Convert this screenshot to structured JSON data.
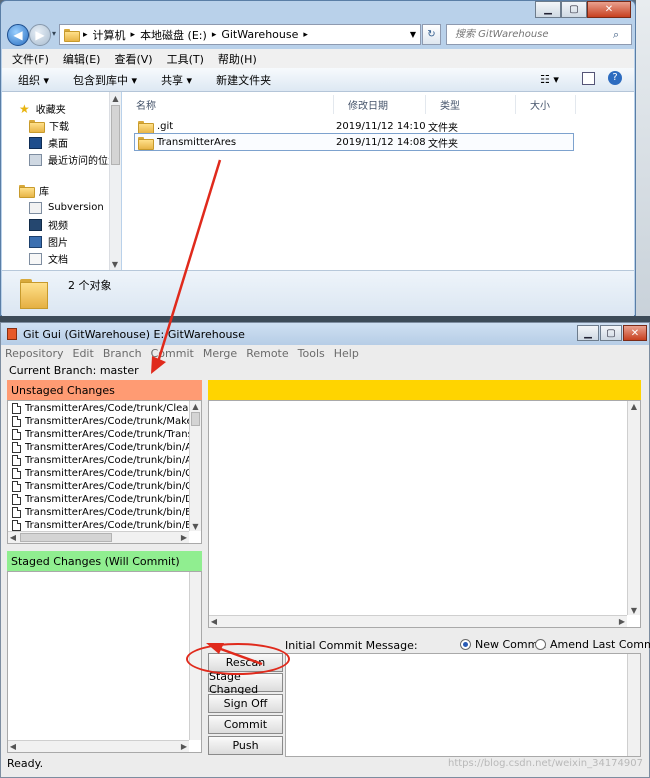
{
  "explorer": {
    "breadcrumb": [
      "计算机",
      "本地磁盘 (E:)",
      "GitWarehouse"
    ],
    "search_placeholder": "搜索 GitWarehouse",
    "menu": [
      "文件(F)",
      "编辑(E)",
      "查看(V)",
      "工具(T)",
      "帮助(H)"
    ],
    "toolbar": [
      "组织 ▾",
      "包含到库中 ▾",
      "共享 ▾",
      "新建文件夹"
    ],
    "nav": {
      "favorites": "收藏夹",
      "fav_items": [
        "下载",
        "桌面",
        "最近访问的位置"
      ],
      "library": "库",
      "lib_items": [
        "Subversion",
        "视频",
        "图片",
        "文档"
      ]
    },
    "columns": [
      "名称",
      "修改日期",
      "类型",
      "大小"
    ],
    "files": [
      {
        "name": ".git",
        "date": "2019/11/12 14:10",
        "type": "文件夹"
      },
      {
        "name": "TransmitterAres",
        "date": "2019/11/12 14:08",
        "type": "文件夹"
      }
    ],
    "status": "2 个对象"
  },
  "gitgui": {
    "title": "Git Gui (GitWarehouse) E:/GitWarehouse",
    "menu": [
      "Repository",
      "Edit",
      "Branch",
      "Commit",
      "Merge",
      "Remote",
      "Tools",
      "Help"
    ],
    "branch": "Current Branch: master",
    "unstaged_title": "Unstaged Changes",
    "unstaged_files": [
      "TransmitterAres/Code/trunk/CleanSo",
      "TransmitterAres/Code/trunk/Makefil",
      "TransmitterAres/Code/trunk/Transm",
      "TransmitterAres/Code/trunk/bin/ACI",
      "TransmitterAres/Code/trunk/bin/ACI",
      "TransmitterAres/Code/trunk/bin/Clo",
      "TransmitterAres/Code/trunk/bin/Cor",
      "TransmitterAres/Code/trunk/bin/Dev",
      "TransmitterAres/Code/trunk/bin/Env",
      "TransmitterAres/Code/trunk/bin/Env"
    ],
    "staged_title": "Staged Changes (Will Commit)",
    "commit_label": "Initial Commit Message:",
    "radio_new": "New Commit",
    "radio_amend": "Amend Last Commit",
    "buttons": {
      "rescan": "Rescan",
      "stage": "Stage Changed",
      "signoff": "Sign Off",
      "commit": "Commit",
      "push": "Push"
    },
    "status": "Ready."
  },
  "watermark": "https://blog.csdn.net/weixin_34174907",
  "colors": {
    "unstaged_header": "#ff9b73",
    "staged_header": "#90ee90",
    "diff_header": "#ffd400",
    "annotation": "#e02a1c"
  }
}
